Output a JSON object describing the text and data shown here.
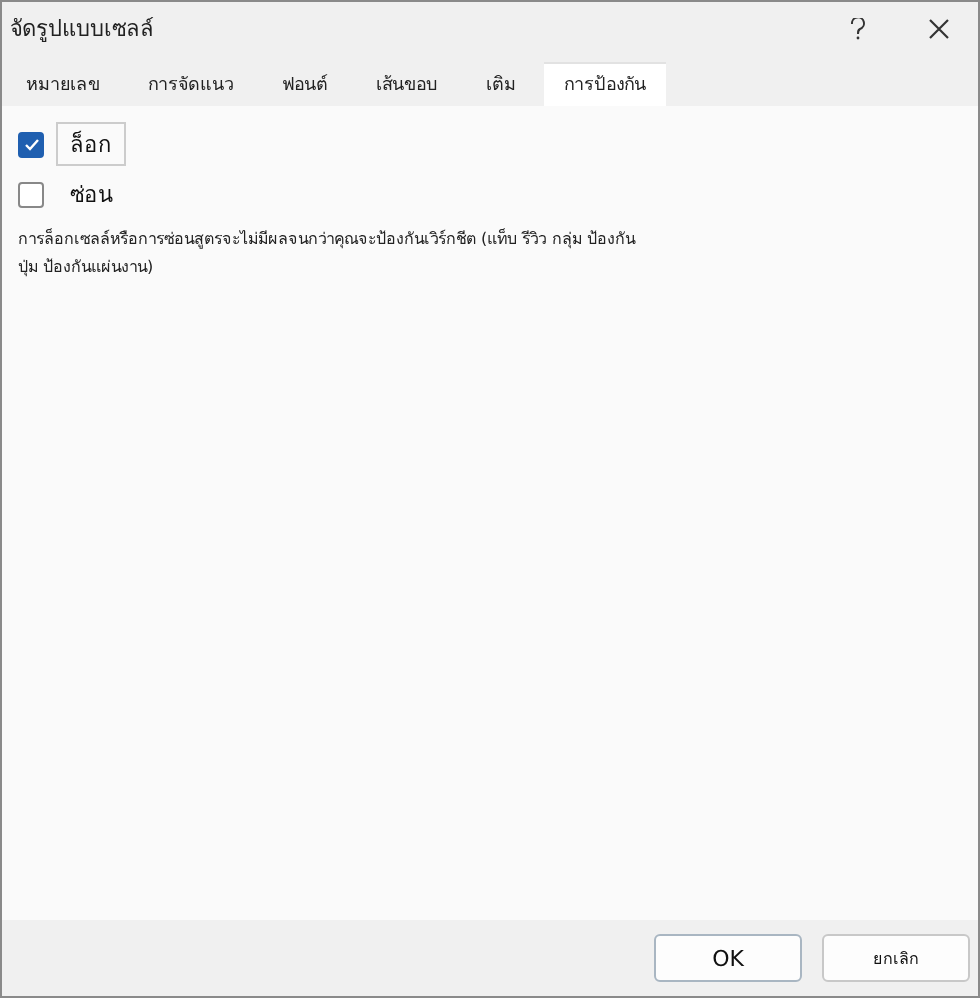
{
  "window": {
    "title": "จัดรูปแบบเซลล์"
  },
  "tabs": [
    {
      "label": "หมายเลข",
      "selected": false
    },
    {
      "label": "การจัดแนว",
      "selected": false
    },
    {
      "label": "ฟอนต์",
      "selected": false
    },
    {
      "label": "เส้นขอบ",
      "selected": false
    },
    {
      "label": "เติม",
      "selected": false
    },
    {
      "label": "การป้องกัน",
      "selected": true
    }
  ],
  "options": [
    {
      "label": "ล็อก",
      "checked": true
    },
    {
      "label": "ซ่อน",
      "checked": false
    }
  ],
  "note": "การล็อกเซลล์หรือการซ่อนสูตรจะไม่มีผลจนกว่าคุณจะป้องกันเวิร์กชีต (แท็บ รีวิว กลุ่ม ป้องกัน ปุ่ม ป้องกันแผ่นงาน)",
  "buttons": [
    {
      "label": "OK",
      "kind": "primary"
    },
    {
      "label": "ยกเลิก",
      "kind": "secondary"
    }
  ]
}
